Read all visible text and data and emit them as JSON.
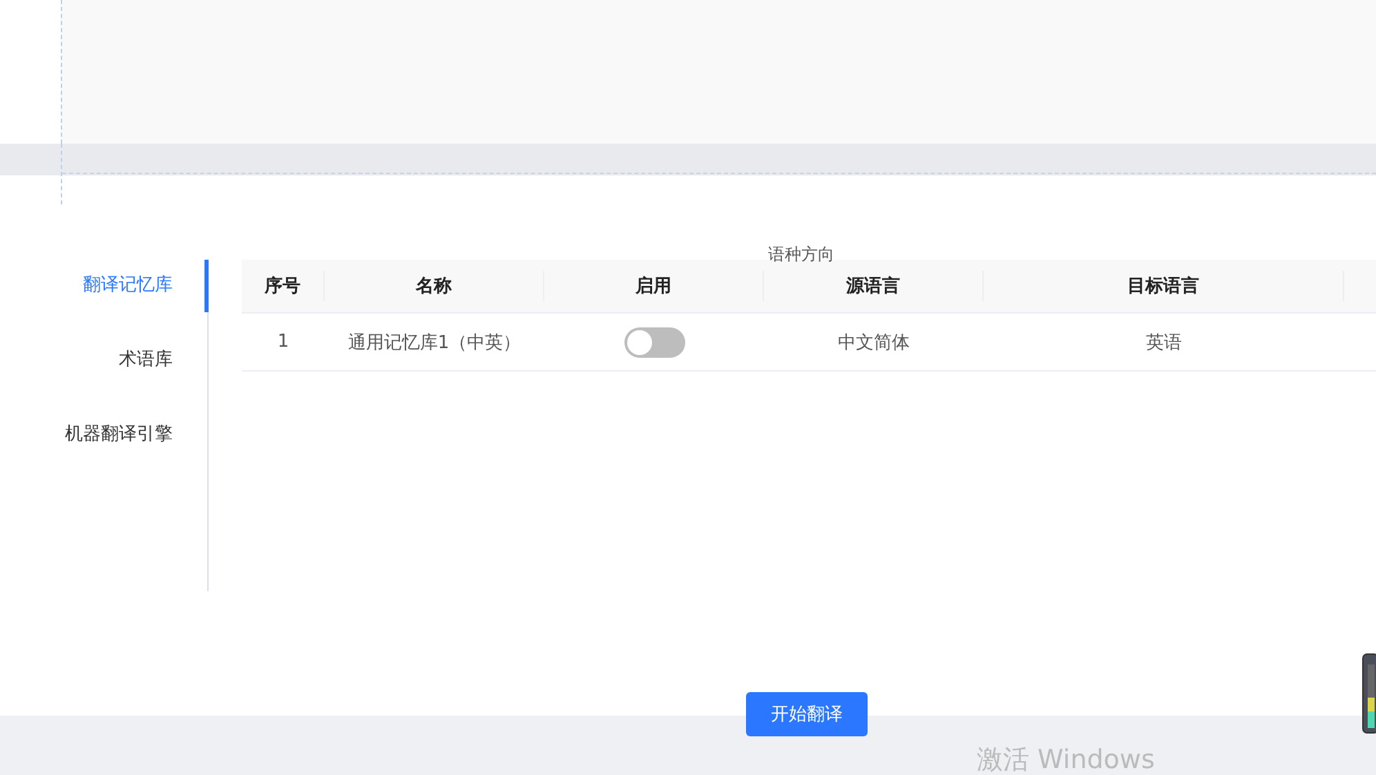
{
  "sidebar": {
    "items": [
      {
        "label": "翻译记忆库",
        "selected": true
      },
      {
        "label": "术语库",
        "selected": false
      },
      {
        "label": "机器翻译引擎",
        "selected": false
      }
    ]
  },
  "table": {
    "group_header": "语种方向",
    "columns": [
      "序号",
      "名称",
      "启用",
      "源语言",
      "目标语言"
    ],
    "rows": [
      {
        "index": "1",
        "name": "通用记忆库1（中英）",
        "enabled": false,
        "source": "中文简体",
        "target": "英语"
      }
    ]
  },
  "start_button": "开始翻译",
  "activation_notice": "激活 Windows"
}
